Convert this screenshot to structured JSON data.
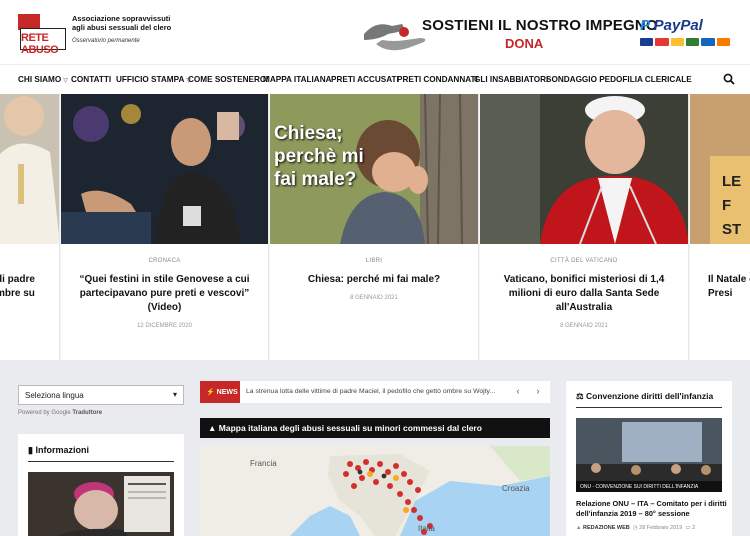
{
  "header": {
    "logo_word": "RETE ABUSO",
    "logo_tagline": "Associazione sopravvissuti agli abusi sessuali del clero",
    "logo_sub": "Osservatorio permanente",
    "banner_text": "SOSTIENI IL NOSTRO IMPEGNO",
    "banner_cta": "DONA",
    "paypal_label": "PayPal"
  },
  "nav": {
    "items": [
      {
        "label": "CHI SIAMO",
        "dropdown": true
      },
      {
        "label": "CONTATTI",
        "dropdown": false
      },
      {
        "label": "UFFICIO STAMPA",
        "dropdown": true
      },
      {
        "label": "COME SOSTENERCI",
        "dropdown": false
      },
      {
        "label": "MAPPA ITALIANA",
        "dropdown": false
      },
      {
        "label": "PRETI ACCUSATI",
        "dropdown": false
      },
      {
        "label": "PRETI CONDANNATI",
        "dropdown": false
      },
      {
        "label": "GLI INSABBIATORI",
        "dropdown": false
      },
      {
        "label": "SONDAGGIO PEDOFILIA CLERICALE",
        "dropdown": false
      }
    ]
  },
  "slider": {
    "slides": [
      {
        "category": "",
        "title": "di padre\nmbre su",
        "date": ""
      },
      {
        "category": "CRONACA",
        "title": "“Quei festini in stile Genovese a cui partecipavano pure preti e vescovi” (Video)",
        "date": "12 DICEMBRE 2020"
      },
      {
        "category": "LIBRI",
        "title": "Chiesa: perché mi fai male?",
        "date": "8 GENNAIO 2021",
        "image_text": "Chiesa; perchè mi fai male?"
      },
      {
        "category": "CITTÀ DEL VATICANO",
        "title": "Vaticano, bonifici misteriosi di 1,4 milioni di euro dalla Santa Sede all'Australia",
        "date": "8 GENNAIO 2021"
      },
      {
        "category": "",
        "title": "Il Natale c\nPresi",
        "date": "",
        "image_text": "LE\nF\nST"
      }
    ]
  },
  "sidebar_left": {
    "language_select": "Seleziona lingua",
    "powered_by": "Powered by",
    "google": "Google",
    "translate": "Traduttore",
    "info_heading": "Informazioni"
  },
  "news_ticker": {
    "tag": "NEWS",
    "text": "La strenua lotta delle vittime di padre Maciel, il pedofilo che gettò ombre su Wojty..."
  },
  "map_section": {
    "heading": "Mappa italiana degli abusi sessuali su minori commessi dal clero",
    "labels": {
      "francia": "Francia",
      "croazia": "Croazia",
      "italia": "Italia"
    }
  },
  "sidebar_right": {
    "heading": "Convenzione diritti dell'infanzia",
    "image_caption": "ONU - CONVENZIONE SUI DIRITTI DELL'INFANZIA",
    "post_title": "Relazione ONU – ITA – Comitato per i diritti dell'infanzia 2019 – 80° sessione",
    "author": "REDAZIONE WEB",
    "date": "28 Febbraio 2019",
    "comments": "2"
  },
  "colors": {
    "accent_red": "#c62828",
    "paypal_blue": "#1b3a8c"
  }
}
